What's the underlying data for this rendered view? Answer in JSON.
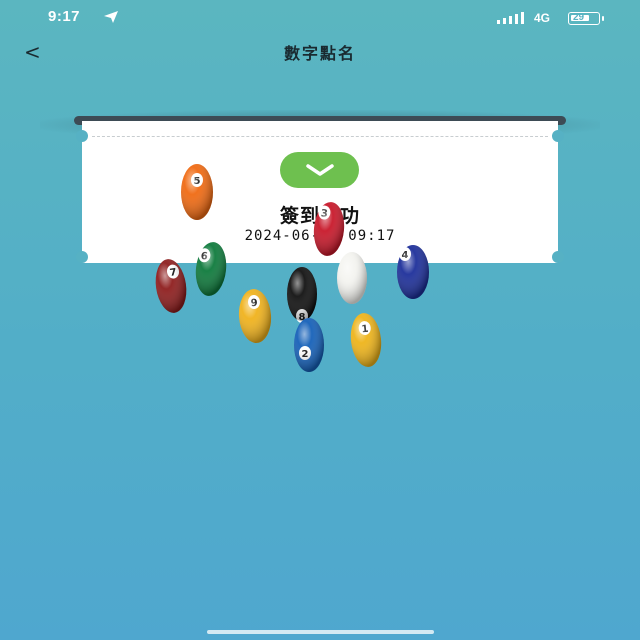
{
  "status_bar": {
    "time": "9:17",
    "network": "4G",
    "battery": "29"
  },
  "nav": {
    "back_label": "<",
    "title": "數字點名"
  },
  "ticket": {
    "title": "簽到成功",
    "timestamp": "2024-06-06 09:17"
  },
  "balls": [
    {
      "number": "5",
      "color": "#f06a12"
    },
    {
      "number": "7",
      "color": "#8e1d1d"
    },
    {
      "number": "6",
      "color": "#0e7a3c"
    },
    {
      "number": "3",
      "color": "#c8182a"
    },
    {
      "number": "9",
      "color": "#f0b21c"
    },
    {
      "number": "8",
      "color": "#111111"
    },
    {
      "number": "",
      "color": "#f4f4f0"
    },
    {
      "number": "2",
      "color": "#1560b8"
    },
    {
      "number": "4",
      "color": "#1d2f9a"
    },
    {
      "number": "1",
      "color": "#eeb41a"
    }
  ],
  "colors": {
    "accent_check": "#6ec04f",
    "background": "#56b1c4",
    "slot": "#3d4b55"
  }
}
